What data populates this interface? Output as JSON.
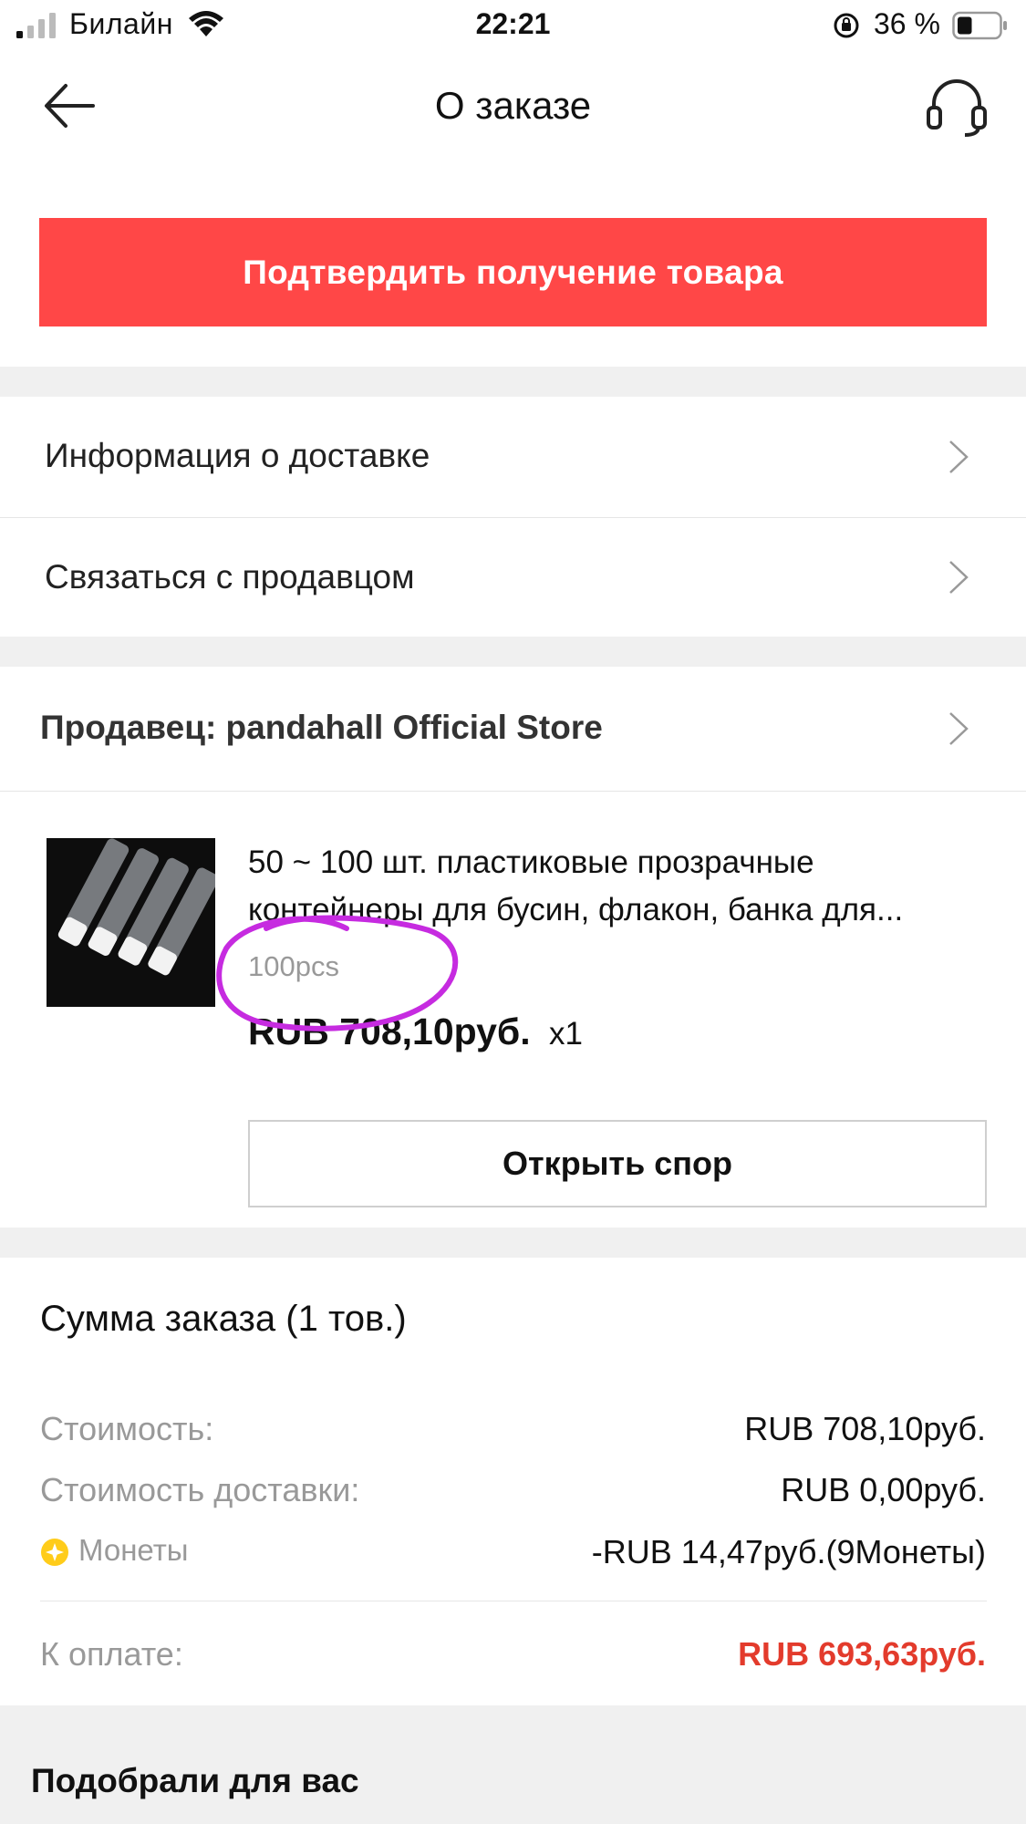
{
  "status_bar": {
    "carrier": "Билайн",
    "time": "22:21",
    "battery_percent": "36 %",
    "battery_level": 0.36
  },
  "nav": {
    "title": "О заказе"
  },
  "confirm_button": {
    "label": "Подтвердить получение товара",
    "color": "#ff4747"
  },
  "menu_rows": [
    {
      "label": "Информация о доставке"
    },
    {
      "label": "Связаться с продавцом"
    }
  ],
  "seller": {
    "label": "Продавец: pandahall Official Store"
  },
  "product": {
    "title": "50 ~ 100 шт. пластиковые прозрачные контейнеры для бусин, флакон, банка для...",
    "variant": "100pcs",
    "price": "RUB 708,10руб.",
    "quantity": "x1",
    "dispute_button": "Открыть спор",
    "annotation_color": "#c62be0"
  },
  "summary": {
    "title": "Сумма заказа (1 тов.)",
    "cost_label": "Стоимость:",
    "cost_value": "RUB 708,10руб.",
    "shipping_label": "Стоимость доставки:",
    "shipping_value": "RUB 0,00руб.",
    "coins_label": "Монеты",
    "coins_value": "-RUB 14,47руб.(9Монеты)",
    "total_label": "К оплате:",
    "total_value": "RUB 693,63руб.",
    "total_color": "#e33b2c"
  },
  "recommendations": {
    "title": "Подобрали для вас"
  }
}
